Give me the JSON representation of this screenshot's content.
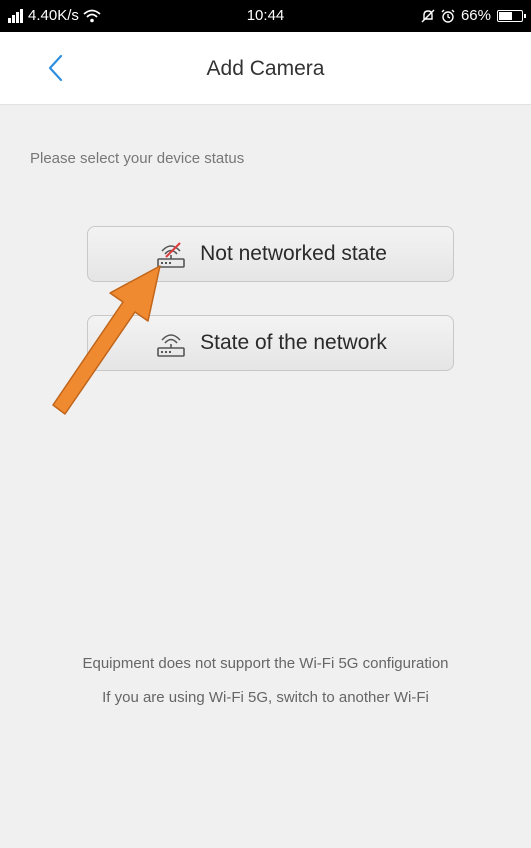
{
  "status_bar": {
    "network_speed": "4.40K/s",
    "time": "10:44",
    "battery": "66%",
    "battery_level": 0.66
  },
  "header": {
    "title": "Add Camera",
    "back_icon": "chevron-left-icon"
  },
  "main": {
    "prompt": "Please select your device status",
    "options": [
      {
        "label": "Not networked state",
        "icon": "router-disconnected-icon"
      },
      {
        "label": "State of the network",
        "icon": "router-icon"
      }
    ]
  },
  "notice": {
    "line1": "Equipment does not support the Wi-Fi 5G configuration",
    "line2": "If you are using Wi-Fi 5G, switch to another Wi-Fi"
  },
  "colors": {
    "accent": "#2f8fde",
    "annotation_arrow": "#f08a30",
    "disconnected_slash": "#e0393b"
  }
}
